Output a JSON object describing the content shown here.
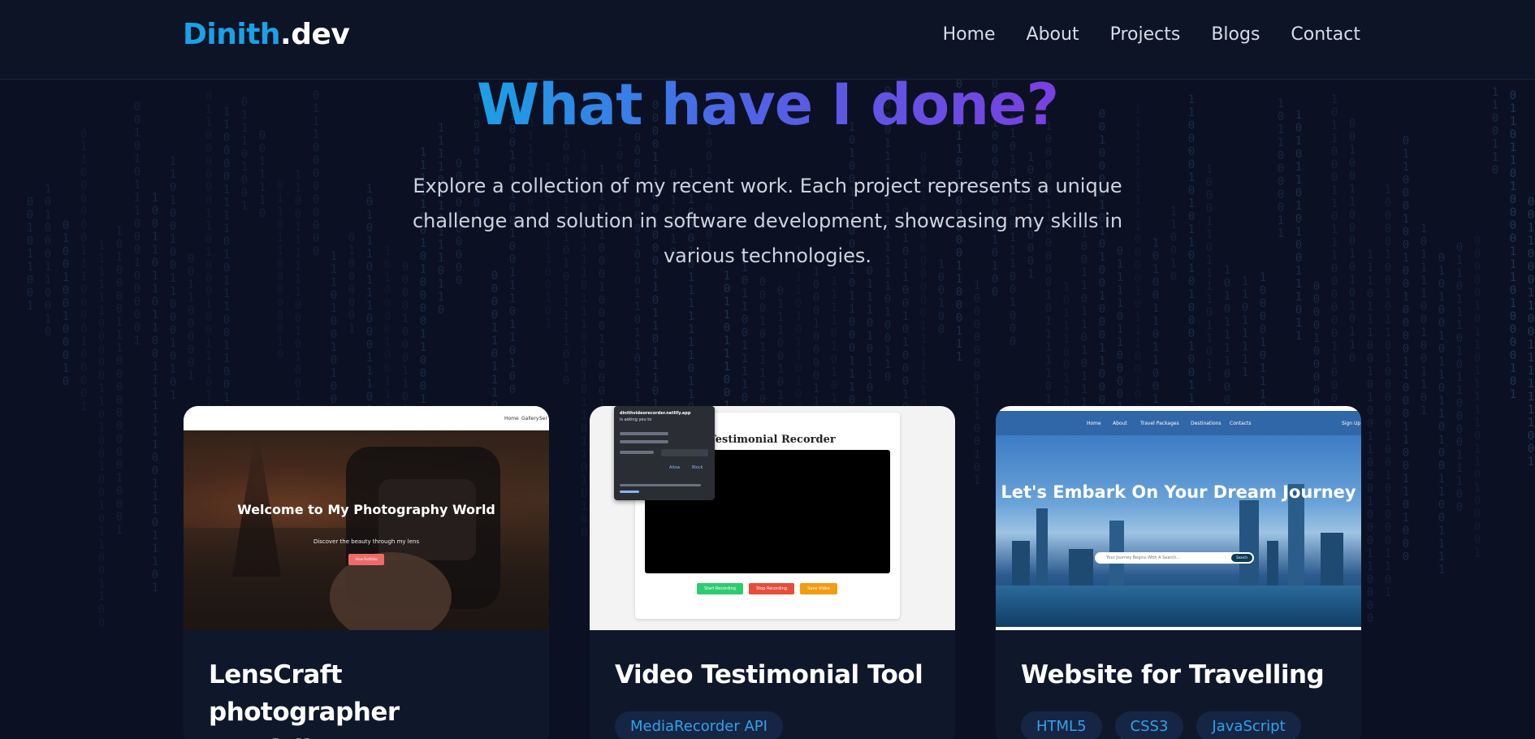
{
  "logo": {
    "first": "Dinith",
    "second": ".dev"
  },
  "nav": {
    "items": [
      "Home",
      "About",
      "Projects",
      "Blogs",
      "Contact"
    ]
  },
  "hero": {
    "title": "What have I done?",
    "subtitle": "Explore a collection of my recent work. Each project represents a unique challenge and solution in software development, showcasing my skills in various technologies."
  },
  "projects": [
    {
      "title": "LensCraft photographer portfolio",
      "tags": [],
      "preview": {
        "nav": [
          "Home",
          "Gallery",
          "Ser"
        ],
        "heading": "Welcome to My Photography World",
        "sub": "Discover the beauty through my lens",
        "button": "View Portfolio"
      }
    },
    {
      "title": "Video Testimonial Tool",
      "tags": [
        "MediaRecorder API"
      ],
      "preview": {
        "heading": "deo Testimonial Recorder",
        "buttons": [
          "Start Recording",
          "Stop Recording",
          "Save Video"
        ],
        "popup_site": "dinithvideorecorder.netlify.app",
        "popup_text": "is asking you to",
        "popup_allow": "Allow",
        "popup_block": "Block"
      }
    },
    {
      "title": "Website for Travelling",
      "tags": [
        "HTML5",
        "CSS3",
        "JavaScript"
      ],
      "preview": {
        "nav": [
          "Home",
          "About",
          "Travel Packages",
          "Destinations",
          "Contacts"
        ],
        "nav_right": "Sign Up",
        "heading": "Let's Embark On Your Dream Journey",
        "search": "Your Journey Begins With A Search...",
        "search_btn": "Search"
      }
    }
  ],
  "colors": {
    "background": "#0b1122",
    "accent": "#1aa1e6",
    "gradient_end": "#7a3fe0",
    "tag_bg": "#162543",
    "tag_text": "#2ea3ea"
  }
}
